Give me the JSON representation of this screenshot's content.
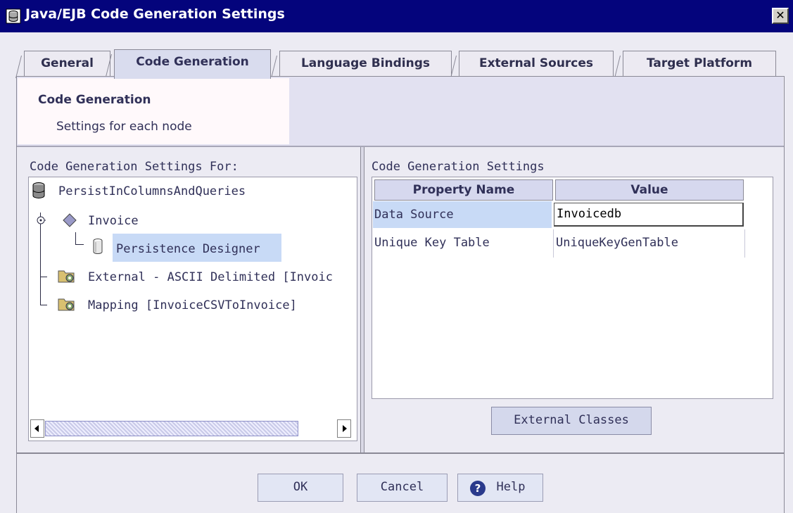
{
  "window": {
    "title": "Java/EJB Code Generation Settings",
    "close_glyph": "✕",
    "title_icon": "database-icon"
  },
  "tabs": [
    {
      "label": "General"
    },
    {
      "label": "Code Generation"
    },
    {
      "label": "Language Bindings"
    },
    {
      "label": "External Sources"
    },
    {
      "label": "Target Platform"
    }
  ],
  "active_tab": "Code Generation",
  "header": {
    "title": "Code Generation",
    "subtitle": "Settings for each node"
  },
  "left_panel": {
    "label": "Code Generation Settings For:",
    "tree": [
      {
        "label": "PersistInColumnsAndQueries",
        "icon": "database-icon"
      },
      {
        "label": "Invoice",
        "icon": "diamond-icon"
      },
      {
        "label": "Persistence Designer",
        "icon": "cylinder-icon",
        "selected": true
      },
      {
        "label": "External - ASCII Delimited [Invoic",
        "icon": "folder-gear-icon"
      },
      {
        "label": "Mapping [InvoiceCSVToInvoice]",
        "icon": "folder-gear-icon"
      }
    ]
  },
  "right_panel": {
    "label": "Code Generation Settings",
    "columns": [
      "Property Name",
      "Value"
    ],
    "rows": [
      {
        "property": "Data Source",
        "value": "Invoicedb",
        "selected": true
      },
      {
        "property": "Unique Key Table",
        "value": "UniqueKeyGenTable"
      }
    ],
    "external_classes_button": "External Classes"
  },
  "buttons": {
    "ok": "OK",
    "cancel": "Cancel",
    "help": "Help"
  },
  "colors": {
    "titlebar": "#04047c",
    "selection": "#c8daf6",
    "panel_bg": "#ecebf3"
  }
}
